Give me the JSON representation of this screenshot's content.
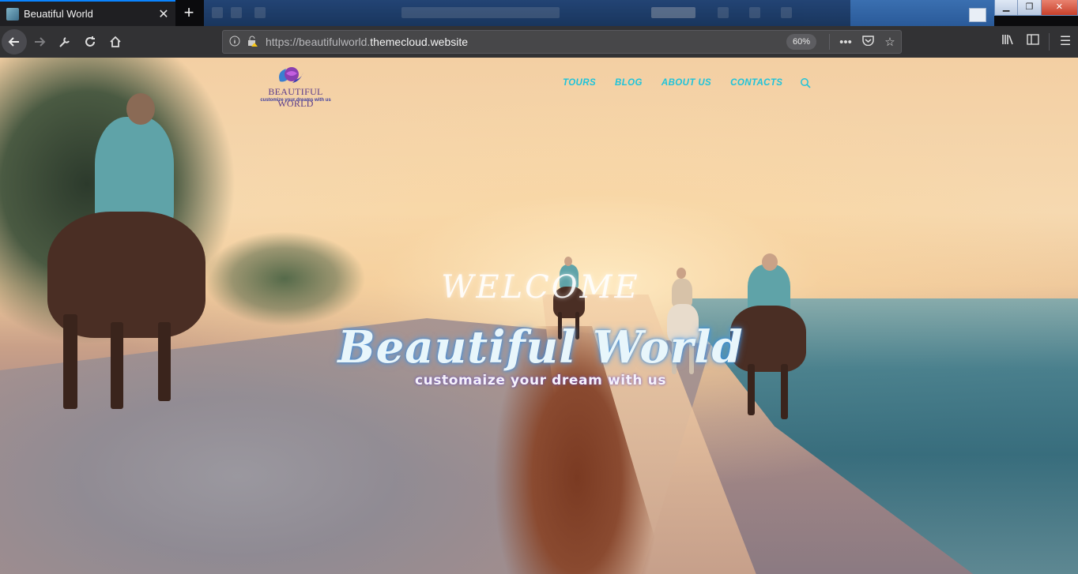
{
  "browser": {
    "tab_title": "Beuatiful World",
    "tab_close": "✕",
    "new_tab": "+",
    "url_prefix": "https://beautifulworld.",
    "url_domain": "themecloud.website",
    "zoom": "60%",
    "window_controls": {
      "minimize": "▁",
      "restore": "❐",
      "close": "✕"
    }
  },
  "site": {
    "logo_name": "BEAUTIFUL WORLD",
    "logo_tagline": "customize your dreams with us",
    "nav": [
      "TOURS",
      "BLOG",
      "ABOUT US",
      "CONTACTS"
    ],
    "hero_welcome": "WELCOME",
    "hero_title": "Beautiful World",
    "hero_subtitle": "customaize your dream with us"
  },
  "colors": {
    "nav_accent": "#1ec3da",
    "browser_accent": "#0a84ff",
    "logo_purple": "#5b3c8a"
  },
  "icons": [
    "back-arrow-icon",
    "forward-arrow-icon",
    "wrench-icon",
    "reload-icon",
    "home-icon",
    "info-icon",
    "lock-warning-icon",
    "more-actions-icon",
    "pocket-icon",
    "bookmark-star-icon",
    "library-icon",
    "sidebar-icon",
    "menu-icon",
    "search-icon"
  ]
}
